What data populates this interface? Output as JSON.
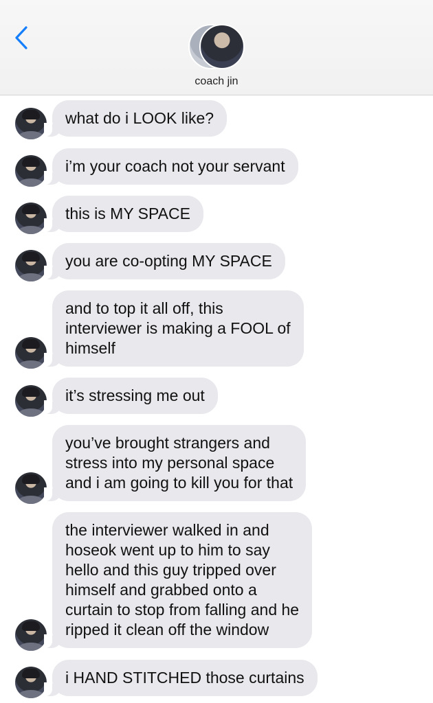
{
  "header": {
    "contact_name": "coach jin"
  },
  "icons": {
    "back": "chevron-left-icon"
  },
  "colors": {
    "accent": "#147efb",
    "bubble_incoming": "#e8e8ed",
    "header_bg": "#f7f7f7"
  },
  "messages": [
    {
      "text": "what do i LOOK like?"
    },
    {
      "text": "i’m your coach not your servant"
    },
    {
      "text": "this is MY SPACE"
    },
    {
      "text": "you are co-opting MY SPACE"
    },
    {
      "text": "and to top it all off, this\ninterviewer is making a FOOL of\nhimself"
    },
    {
      "text": "it’s stressing me out"
    },
    {
      "text": "you’ve brought strangers and\nstress into my personal space\nand i am going to kill you for that"
    },
    {
      "text": "the interviewer walked in and\nhoseok went up to him to say\nhello and this guy tripped over\nhimself and grabbed onto a\ncurtain to stop from falling and he\nripped it clean off the window"
    },
    {
      "text": "i HAND STITCHED those curtains"
    }
  ]
}
